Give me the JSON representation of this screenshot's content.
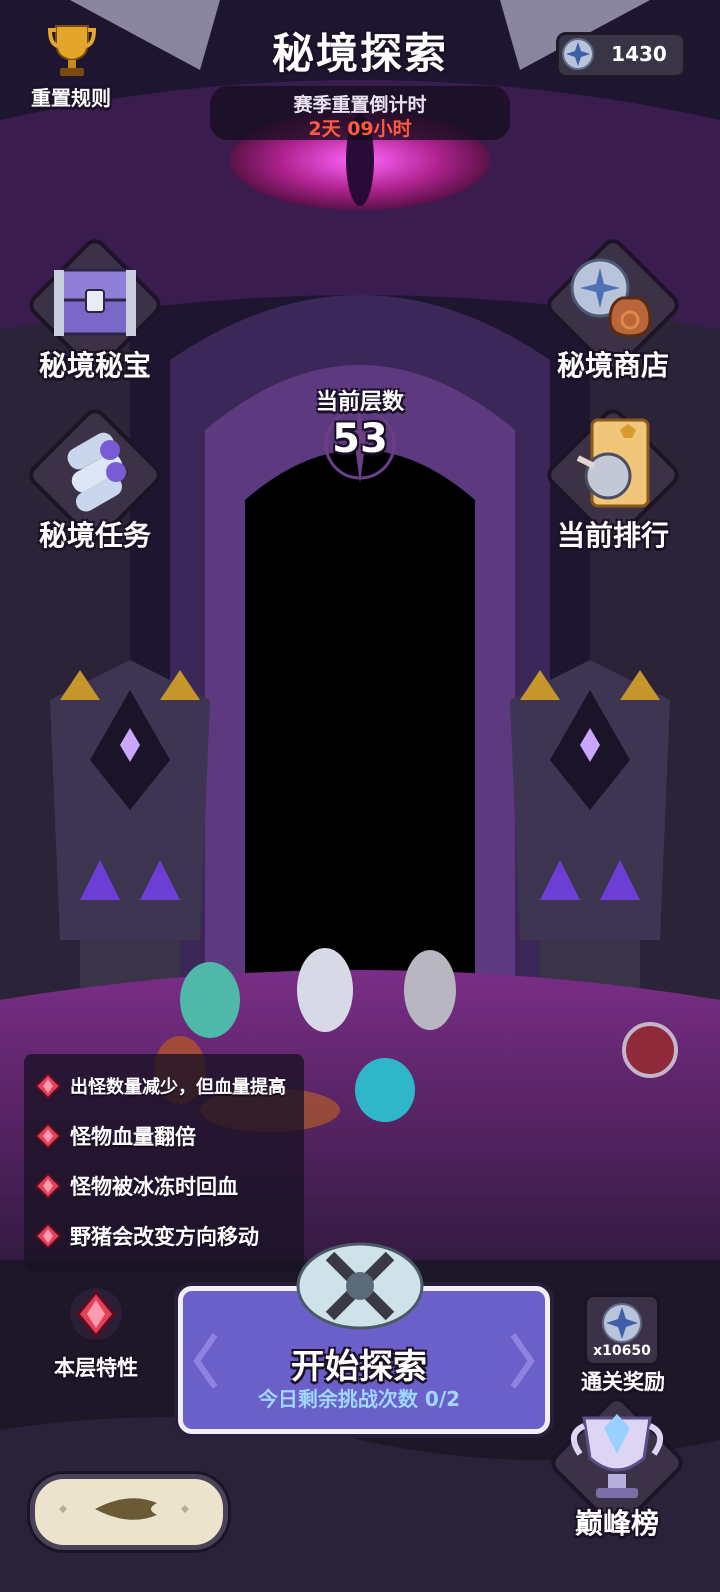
{
  "header": {
    "title": "秘境探索",
    "countdown_label": "赛季重置倒计时",
    "countdown_value": "2天 09小时",
    "reset_rules_label": "重置规则",
    "currency_amount": "1430"
  },
  "menu": {
    "treasure": "秘境秘宝",
    "shop": "秘境商店",
    "tasks": "秘境任务",
    "ranking": "当前排行"
  },
  "floor": {
    "label": "当前层数",
    "value": "53"
  },
  "traits": [
    "出怪数量减少，但血量提高",
    "怪物血量翻倍",
    "怪物被冰冻时回血",
    "野猪会改变方向移动"
  ],
  "bottom": {
    "floor_trait_label": "本层特性",
    "start_label": "开始探索",
    "remaining_label": "今日剩余挑战次数 0/2",
    "reward_count": "x10650",
    "reward_label": "通关奖励",
    "peak_label": "巅峰榜"
  },
  "colors": {
    "accent_red": "#ff5a3c",
    "button_purple": "#6b5fc9",
    "gem_red": "#e8405a"
  }
}
